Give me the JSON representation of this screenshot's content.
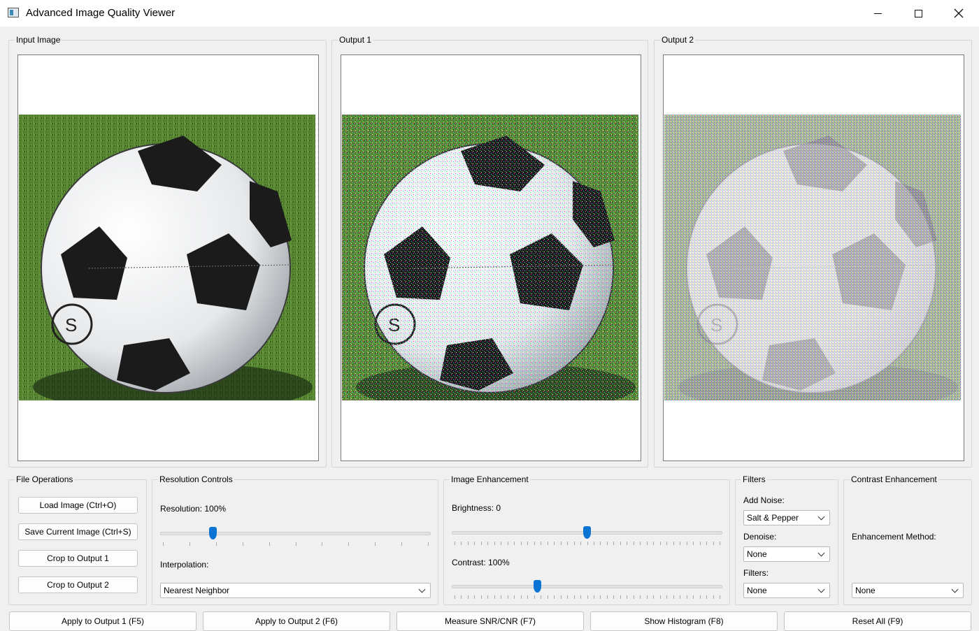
{
  "window": {
    "title": "Advanced Image Quality Viewer"
  },
  "panels": {
    "input": {
      "title": "Input Image"
    },
    "output1": {
      "title": "Output 1"
    },
    "output2": {
      "title": "Output 2"
    }
  },
  "file_operations": {
    "title": "File Operations",
    "load_label": "Load Image (Ctrl+O)",
    "save_label": "Save Current Image (Ctrl+S)",
    "crop1_label": "Crop to Output 1",
    "crop2_label": "Crop to Output 2"
  },
  "resolution_controls": {
    "title": "Resolution Controls",
    "resolution_label": "Resolution: 100%",
    "resolution_value_pct": 100,
    "interpolation_label": "Interpolation:",
    "interpolation_value": "Nearest Neighbor"
  },
  "image_enhancement": {
    "title": "Image Enhancement",
    "brightness_label": "Brightness: 0",
    "brightness_value": 0,
    "contrast_label": "Contrast: 100%",
    "contrast_value_pct": 100
  },
  "filters": {
    "title": "Filters",
    "add_noise_label": "Add Noise:",
    "add_noise_value": "Salt & Pepper",
    "denoise_label": "Denoise:",
    "denoise_value": "None",
    "filters_label": "Filters:",
    "filters_value": "None"
  },
  "contrast_enhancement": {
    "title": "Contrast Enhancement",
    "method_label": "Enhancement Method:",
    "method_value": "None"
  },
  "actions": {
    "apply1": "Apply to Output 1 (F5)",
    "apply2": "Apply to Output 2 (F6)",
    "measure": "Measure SNR/CNR (F7)",
    "histogram": "Show Histogram (F8)",
    "reset": "Reset All (F9)"
  },
  "colors": {
    "accent": "#0a74d4",
    "grass": "#4a7a2a",
    "ball_black": "#1b1b1b"
  }
}
